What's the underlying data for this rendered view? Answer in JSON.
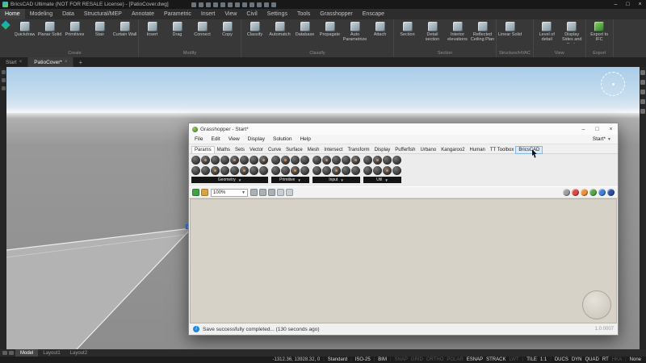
{
  "titlebar": {
    "title": "BricsCAD Ultimate (NOT FOR RESALE License) - [PatioCover.dwg]",
    "quick_access_icons": [
      "new-icon",
      "open-icon",
      "save-icon",
      "save-as-icon",
      "print-icon",
      "undo-icon",
      "redo-icon",
      "cut-icon",
      "copy-icon",
      "paste-icon",
      "workspace-icon",
      "help-icon"
    ],
    "window_controls": [
      {
        "name": "minimize-button",
        "glyph": "–"
      },
      {
        "name": "maximize-button",
        "glyph": "□"
      },
      {
        "name": "close-button",
        "glyph": "×"
      }
    ]
  },
  "menubar": {
    "items": [
      {
        "label": "Home",
        "active": true
      },
      {
        "label": "Modeling"
      },
      {
        "label": "Data"
      },
      {
        "label": "Structural/MEP"
      },
      {
        "label": "Annotate"
      },
      {
        "label": "Parametric"
      },
      {
        "label": "Insert"
      },
      {
        "label": "View"
      },
      {
        "label": "Civil"
      },
      {
        "label": "Settings"
      },
      {
        "label": "Tools"
      },
      {
        "label": "Grasshopper"
      },
      {
        "label": "Enscape"
      }
    ]
  },
  "ribbon": {
    "groups": [
      {
        "label": "Create",
        "buttons": [
          {
            "label": "Quickdraw"
          },
          {
            "label": "Planar Solid"
          },
          {
            "label": "Primitives"
          },
          {
            "label": "Stair"
          },
          {
            "label": "Curtain Wall"
          }
        ]
      },
      {
        "label": "Modify",
        "buttons": [
          {
            "label": "Insert"
          },
          {
            "label": "Drag"
          },
          {
            "label": "Connect"
          },
          {
            "label": "Copy"
          }
        ]
      },
      {
        "label": "Classify",
        "buttons": [
          {
            "label": "Classify"
          },
          {
            "label": "Automatch"
          },
          {
            "label": "Database"
          },
          {
            "label": "Propagate"
          },
          {
            "label": "Auto Parametrize"
          },
          {
            "label": "Attach"
          }
        ]
      },
      {
        "label": "Section",
        "buttons": [
          {
            "label": "Section"
          },
          {
            "label": "Detail section"
          },
          {
            "label": "Interior elevations"
          },
          {
            "label": "Reflected Ceiling Plan"
          }
        ]
      },
      {
        "label": "Structure/HVAC",
        "buttons": [
          {
            "label": "Linear Solid"
          }
        ]
      },
      {
        "label": "View",
        "buttons": [
          {
            "label": "Level of detail"
          },
          {
            "label": "Display Sides and Ends"
          }
        ]
      },
      {
        "label": "Export",
        "buttons": [
          {
            "label": "Export to IFC",
            "accent": true
          }
        ]
      }
    ]
  },
  "doctabs": {
    "tabs": [
      {
        "label": "Start"
      },
      {
        "label": "PatioCover*",
        "active": true
      }
    ],
    "new_tab_label": "+"
  },
  "side_panel_icons": [
    "properties-panel-icon",
    "layers-panel-icon",
    "structure-panel-icon",
    "report-panel-icon",
    "sheets-panel-icon"
  ],
  "left_strip_icons": [
    "edge-toolbar-icon-1",
    "edge-toolbar-icon-2",
    "edge-toolbar-icon-3"
  ],
  "grasshopper": {
    "title": "Grasshopper - Start*",
    "window_controls": [
      {
        "name": "gh-minimize-button",
        "glyph": "–"
      },
      {
        "name": "gh-maximize-button",
        "glyph": "□"
      },
      {
        "name": "gh-close-button",
        "glyph": "×"
      }
    ],
    "menu": [
      "File",
      "Edit",
      "View",
      "Display",
      "Solution",
      "Help"
    ],
    "doc_label": "Start*",
    "tabs": [
      {
        "label": "Params",
        "active": true
      },
      {
        "label": "Maths"
      },
      {
        "label": "Sets"
      },
      {
        "label": "Vector"
      },
      {
        "label": "Curve"
      },
      {
        "label": "Surface"
      },
      {
        "label": "Mesh"
      },
      {
        "label": "Intersect"
      },
      {
        "label": "Transform"
      },
      {
        "label": "Display"
      },
      {
        "label": "Pufferfish"
      },
      {
        "label": "Urbano"
      },
      {
        "label": "Kangaroo2"
      },
      {
        "label": "Human"
      },
      {
        "label": "TT Toolbox"
      },
      {
        "label": "BricsCAD",
        "hover": true
      }
    ],
    "palette_groups": [
      {
        "label": "Geometry",
        "icon_count": 16
      },
      {
        "label": "Primitive",
        "icon_count": 8
      },
      {
        "label": "Input",
        "icon_count": 10
      },
      {
        "label": "Util",
        "icon_count": 8
      }
    ],
    "zoom": "100%",
    "toolbar_left_icons": [
      {
        "name": "save-icon",
        "color": "#43a047"
      },
      {
        "name": "open-icon",
        "color": "#d9a441"
      }
    ],
    "toolbar_mid_icons": [
      {
        "name": "zoom-target-icon",
        "color": "#aab2b8"
      },
      {
        "name": "preview-eye-icon",
        "color": "#aab2b8"
      },
      {
        "name": "sketch-icon",
        "color": "#aab2b8"
      },
      {
        "name": "group-icon",
        "color": "#c9cfd4"
      },
      {
        "name": "widget-icon",
        "color": "#c9cfd4"
      }
    ],
    "preview_balls": [
      {
        "name": "preview-off-ball",
        "color": "#9e9e9e"
      },
      {
        "name": "preview-wire-ball",
        "color": "#d84a44"
      },
      {
        "name": "preview-custom-ball",
        "color": "#ef8e3b"
      },
      {
        "name": "preview-shaded-ball",
        "color": "#58a449"
      },
      {
        "name": "selected-preview-ball",
        "color": "#3f7fd6"
      },
      {
        "name": "remote-panel-ball",
        "color": "#2d4f9e"
      }
    ],
    "status_text": "Save successfully completed... (130 seconds ago)",
    "version": "1.0.0007"
  },
  "modeltabs": {
    "icons": [
      "layout-menu-icon",
      "model-space-icon"
    ],
    "tabs": [
      {
        "label": "Model",
        "active": true
      },
      {
        "label": "Layout1"
      },
      {
        "label": "Layout2"
      }
    ]
  },
  "statusbar": {
    "coords": "-1312.36, 13928.32, 0",
    "items": [
      {
        "label": "Standard",
        "on": true
      },
      {
        "sep": true
      },
      {
        "label": "ISO-25",
        "on": true
      },
      {
        "sep": true
      },
      {
        "label": "BIM",
        "on": true
      },
      {
        "sep": true
      },
      {
        "label": "SNAP",
        "on": false
      },
      {
        "label": "GRID",
        "on": false
      },
      {
        "label": "ORTHO",
        "on": false
      },
      {
        "label": "POLAR",
        "on": false
      },
      {
        "label": "ESNAP",
        "on": true
      },
      {
        "label": "STRACK",
        "on": true
      },
      {
        "label": "LWT",
        "on": false
      },
      {
        "sep": true
      },
      {
        "label": "TILE",
        "on": true
      },
      {
        "label": "1:1",
        "on": true
      },
      {
        "sep": true
      },
      {
        "label": "DUCS",
        "on": true
      },
      {
        "label": "DYN",
        "on": true
      },
      {
        "label": "QUAD",
        "on": true
      },
      {
        "label": "RT",
        "on": true
      },
      {
        "label": "HKA",
        "on": false
      },
      {
        "sep": true
      },
      {
        "label": "None",
        "on": true
      }
    ]
  }
}
